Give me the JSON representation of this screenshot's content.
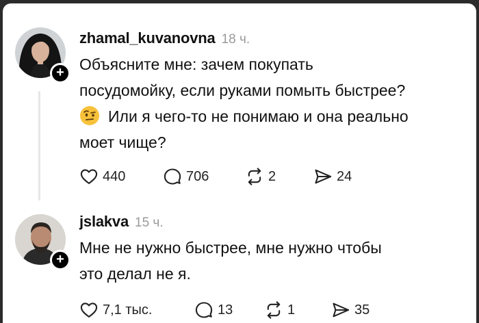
{
  "posts": [
    {
      "username": "zhamal_kuvanovna",
      "time": "18 ч.",
      "lines": [
        "Объясните мне: зачем покупать",
        "посудомойку, если руками помыть быстрее?",
        "Или я чего-то не понимаю и она реально",
        "моет чище?"
      ],
      "emoji": "raised-eyebrow-emoji",
      "likes": "440",
      "comments": "706",
      "reposts": "2",
      "shares": "24"
    },
    {
      "username": "jslakva",
      "time": "15 ч.",
      "lines": [
        "Мне не нужно быстрее, мне нужно чтобы",
        "это делал не я."
      ],
      "likes": "7,1 тыс.",
      "comments": "13",
      "reposts": "1",
      "shares": "35"
    }
  ],
  "follow_label": "+",
  "icons": {
    "like": "heart-icon",
    "comment": "comment-bubble-icon",
    "repost": "repost-icon",
    "share": "send-icon"
  }
}
